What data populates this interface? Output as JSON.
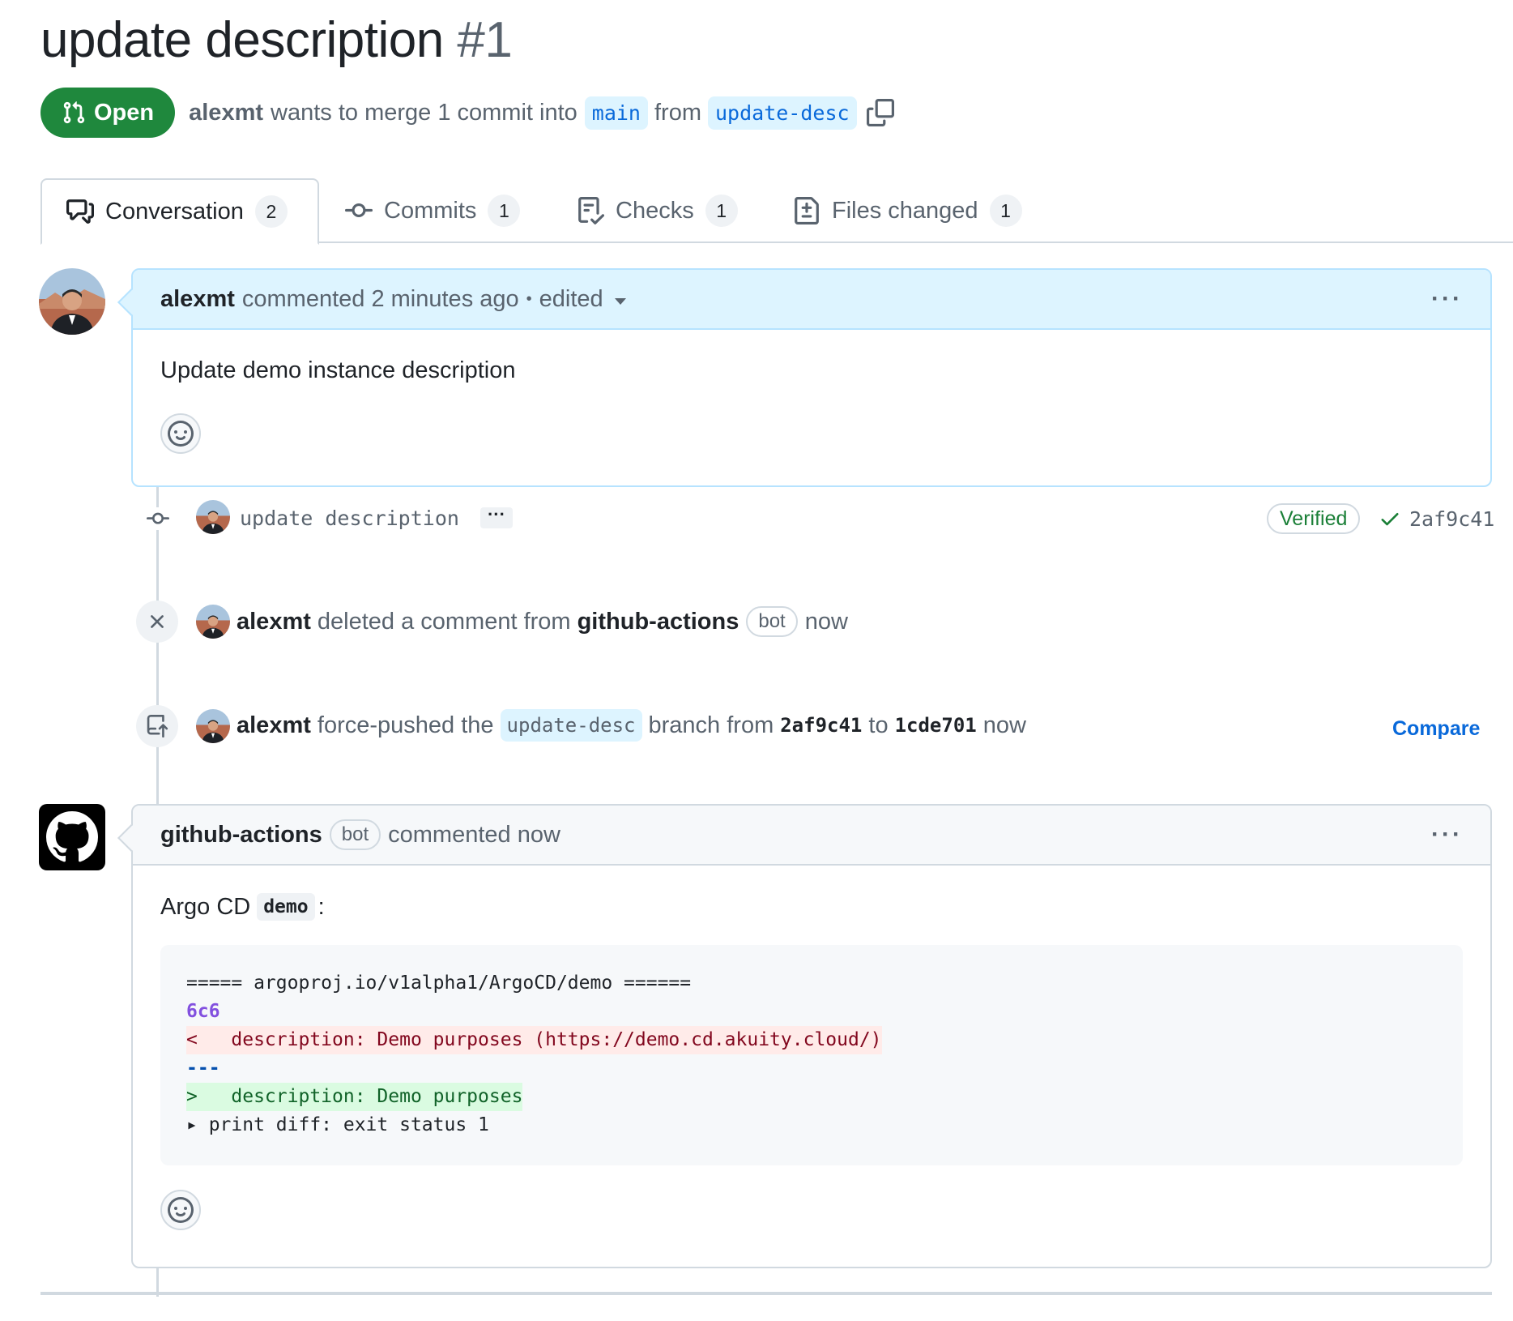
{
  "pr": {
    "title": "update description",
    "number": "#1",
    "state": "Open",
    "author": "alexmt",
    "merge_text": "wants to merge 1 commit into",
    "base_branch": "main",
    "from_text": "from",
    "head_branch": "update-desc"
  },
  "tabs": [
    {
      "label": "Conversation",
      "count": "2"
    },
    {
      "label": "Commits",
      "count": "1"
    },
    {
      "label": "Checks",
      "count": "1"
    },
    {
      "label": "Files changed",
      "count": "1"
    }
  ],
  "first_comment": {
    "author": "alexmt",
    "action": "commented 2 minutes ago",
    "sep": "•",
    "edited": "edited",
    "kebab": "···",
    "body": "Update demo instance description"
  },
  "commit_event": {
    "message": "update description",
    "ellipsis": "···",
    "verified": "Verified",
    "sha": "2af9c41"
  },
  "delete_event": {
    "actor": "alexmt",
    "text": "deleted a comment from",
    "target": "github-actions",
    "bot_label": "bot",
    "time": "now"
  },
  "push_event": {
    "actor": "alexmt",
    "text1": "force-pushed the",
    "branch": "update-desc",
    "text2": "branch from",
    "from_sha": "2af9c41",
    "to_text": "to",
    "to_sha": "1cde701",
    "time": "now",
    "compare": "Compare"
  },
  "bot_comment": {
    "author": "github-actions",
    "bot_label": "bot",
    "action": "commented now",
    "kebab": "···",
    "heading_prefix": "Argo CD",
    "heading_code": "demo",
    "heading_suffix": ":",
    "code_lines": {
      "header": "===== argoproj.io/v1alpha1/ArgoCD/demo ======",
      "hunk": "6c6",
      "del": "<   description: Demo purposes (https://demo.cd.akuity.cloud/)",
      "sep": "---",
      "add": ">   description: Demo purposes",
      "summary": "▸ print diff: exit status 1"
    }
  },
  "colors": {
    "open_green": "#1f883d",
    "link_blue": "#0969da",
    "author_header_bg": "#ddf4ff",
    "verified_green": "#1a7f37"
  },
  "icons": [
    "git-pull-request-icon",
    "copy-icon",
    "comment-discussion-icon",
    "git-commit-icon",
    "checklist-icon",
    "file-diff-icon",
    "kebab-horizontal-icon",
    "smiley-icon",
    "x-icon",
    "repo-push-icon",
    "check-icon",
    "github-mark-icon"
  ]
}
